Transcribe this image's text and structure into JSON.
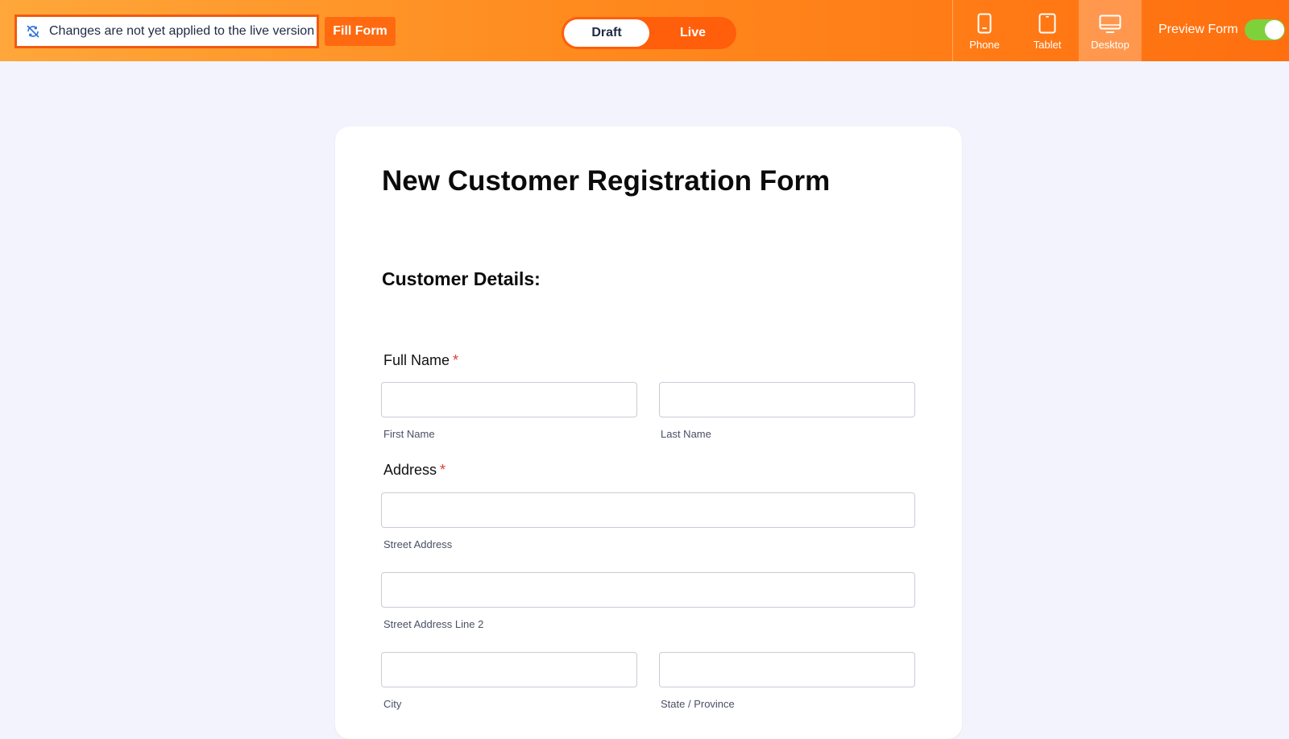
{
  "topbar": {
    "status_text": "Changes are not yet applied to the live version",
    "fill_form_label": "Fill Form",
    "mode_toggle": {
      "draft": "Draft",
      "live": "Live",
      "selected": "Draft"
    },
    "devices": [
      {
        "label": "Phone",
        "icon": "phone-icon",
        "active": false
      },
      {
        "label": "Tablet",
        "icon": "tablet-icon",
        "active": false
      },
      {
        "label": "Desktop",
        "icon": "desktop-icon",
        "active": true
      }
    ],
    "preview_label": "Preview Form",
    "preview_enabled": true
  },
  "form": {
    "title": "New Customer Registration Form",
    "section_title": "Customer Details:",
    "full_name": {
      "label": "Full Name",
      "required_mark": "*",
      "first_name": {
        "value": "",
        "sublabel": "First Name"
      },
      "last_name": {
        "value": "",
        "sublabel": "Last Name"
      }
    },
    "address": {
      "label": "Address",
      "required_mark": "*",
      "street": {
        "value": "",
        "sublabel": "Street Address"
      },
      "street2": {
        "value": "",
        "sublabel": "Street Address Line 2"
      },
      "city": {
        "value": "",
        "sublabel": "City"
      },
      "state": {
        "value": "",
        "sublabel": "State / Province"
      }
    }
  },
  "colors": {
    "accent_orange": "#ff6a10",
    "border_highlight": "#f05a10",
    "toggle_green": "#7fd13b",
    "required_red": "#e53935",
    "background": "#f3f3fd"
  }
}
